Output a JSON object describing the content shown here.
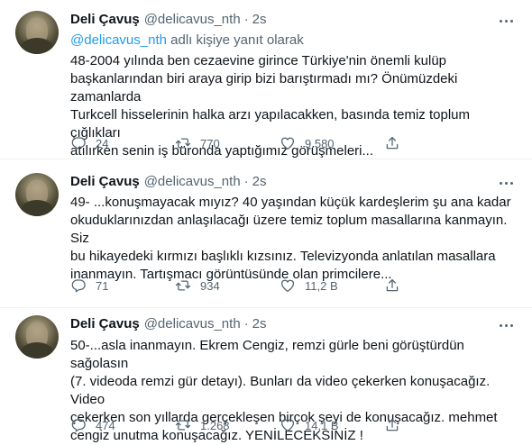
{
  "tweets": [
    {
      "name": "Deli Çavuş",
      "handle": "@delicavus_nth",
      "separator": "·",
      "time": "2s",
      "reply_to": {
        "mention": "@delicavus_nth",
        "suffix": " adlı kişiye yanıt olarak"
      },
      "text": "48-2004 yılında ben cezaevine girince Türkiye'nin önemli kulüp\nbaşkanlarından biri araya girip bizi barıştırmadı mı? Önümüzdeki zamanlarda\nTurkcell hisselerinin halka arzı yapılacakken, basında temiz toplum çığlıkları\natılırken senin iş büronda yaptığımız görüşmeleri...",
      "replies": "24",
      "retweets": "770",
      "likes": "9.580"
    },
    {
      "name": "Deli Çavuş",
      "handle": "@delicavus_nth",
      "separator": "·",
      "time": "2s",
      "text": "49- ...konuşmayacak mıyız? 40 yaşından küçük kardeşlerim şu ana kadar\nokuduklarınızdan anlaşılacağı üzere temiz toplum masallarına kanmayın. Siz\nbu hikayedeki kırmızı başlıklı kızsınız. Televizyonda anlatılan masallara\ninanmayın. Tartışmacı görüntüsünde olan primcilere...",
      "replies": "71",
      "retweets": "934",
      "likes": "11,2 B"
    },
    {
      "name": "Deli Çavuş",
      "handle": "@delicavus_nth",
      "separator": "·",
      "time": "2s",
      "text": "50-...asla inanmayın. Ekrem Cengiz, remzi gürle beni görüştürdün sağolasın\n(7. videoda remzi gür detayı). Bunları da video çekerken konuşacağız. Video\nçekerken son yıllarda gerçekleşen birçok şeyi de konuşacağız. mehmet\ncengiz unutma konuşacağız. YENİLECEKSİNİZ !",
      "replies": "474",
      "retweets": "1.268",
      "likes": "14,1 B"
    }
  ],
  "icons": {
    "reply": "reply-icon",
    "retweet": "retweet-icon",
    "like": "heart-icon",
    "share": "share-icon",
    "more": "more-options-icon"
  }
}
